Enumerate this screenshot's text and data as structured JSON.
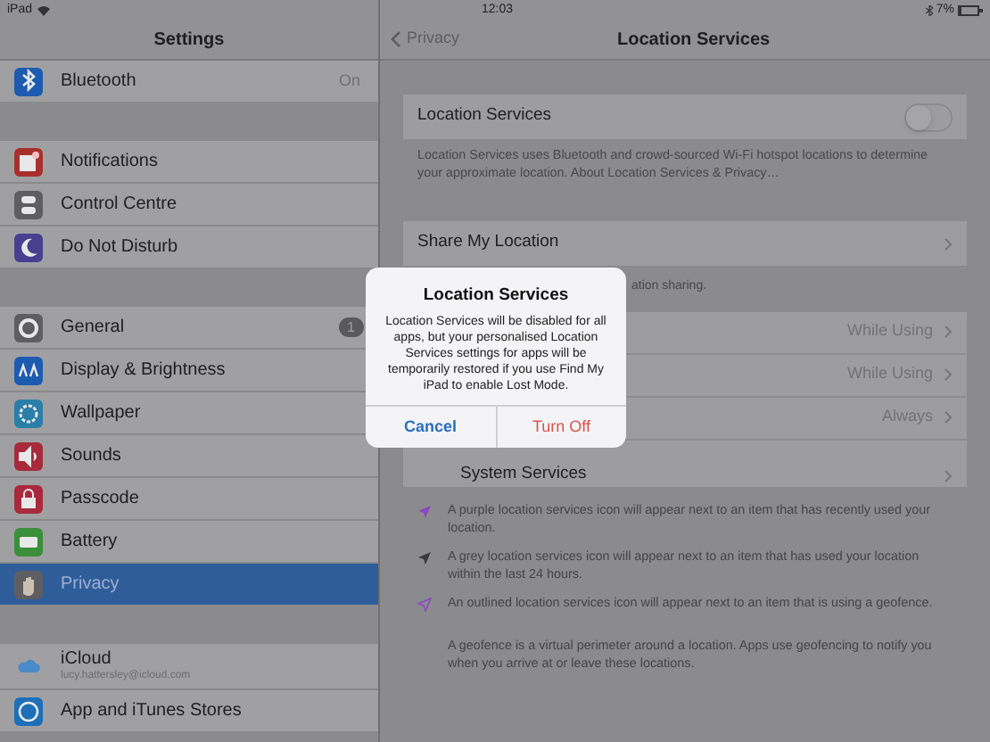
{
  "status_bar": {
    "device": "iPad",
    "time": "12:03",
    "battery": "7%"
  },
  "sidebar": {
    "title": "Settings",
    "groups": [
      {
        "items": [
          {
            "label": "Bluetooth",
            "value": "On",
            "selected": false
          }
        ]
      },
      {
        "items": [
          {
            "label": "Notifications",
            "selected": false
          },
          {
            "label": "Control Centre",
            "selected": false
          },
          {
            "label": "Do Not Disturb",
            "selected": false
          }
        ]
      },
      {
        "items": [
          {
            "label": "General",
            "badge": "1",
            "selected": false
          },
          {
            "label": "Display & Brightness",
            "selected": false
          },
          {
            "label": "Wallpaper",
            "selected": false
          },
          {
            "label": "Sounds",
            "selected": false
          },
          {
            "label": "Passcode",
            "selected": false
          },
          {
            "label": "Battery",
            "selected": false
          },
          {
            "label": "Privacy",
            "selected": true
          }
        ]
      },
      {
        "items": [
          {
            "label": "iCloud",
            "subtitle": "lucy.hattersley@icloud.com",
            "selected": false
          },
          {
            "label": "App and iTunes Stores",
            "selected": false
          }
        ]
      }
    ]
  },
  "detail": {
    "back": "Privacy",
    "title": "Location Services",
    "toggle": {
      "label": "Location Services",
      "on": false
    },
    "toggle_note": "Location Services uses Bluetooth and crowd-sourced Wi-Fi hotspot locations to determine your approximate location. About Location Services & Privacy…",
    "share": {
      "label": "Share My Location"
    },
    "share_note": "ation sharing.",
    "apps": [
      {
        "value": "While Using"
      },
      {
        "value": "While Using"
      },
      {
        "value": "Always"
      }
    ],
    "system": {
      "label": "System Services"
    },
    "legend": [
      {
        "kind": "purple",
        "text": "A purple location services icon will appear next to an item that has recently used your location."
      },
      {
        "kind": "grey",
        "text": "A grey location services icon will appear next to an item that has used your location within the last 24 hours."
      },
      {
        "kind": "outline",
        "text": "An outlined location services icon will appear next to an item that is using a geofence."
      },
      {
        "kind": "plain",
        "text": "A geofence is a virtual perimeter around a location. Apps use geofencing to notify you when you arrive at or leave these locations."
      }
    ]
  },
  "dialog": {
    "title": "Location Services",
    "message": "Location Services will be disabled for all apps, but your personalised Location Services settings for apps will be temporarily restored if you use Find My iPad to enable Lost Mode.",
    "buttons": [
      {
        "label": "Cancel",
        "kind": "cancel"
      },
      {
        "label": "Turn Off",
        "kind": "destructive"
      }
    ]
  }
}
